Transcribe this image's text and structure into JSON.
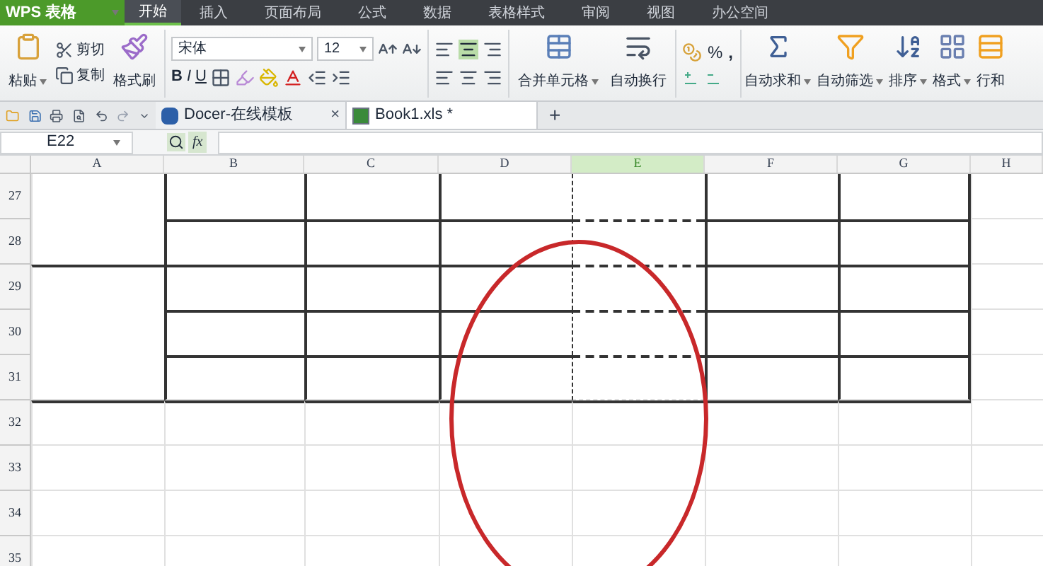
{
  "app_title": "WPS 表格",
  "menu_tabs": [
    {
      "label": "开始",
      "selected": true
    },
    {
      "label": "插入",
      "selected": false
    },
    {
      "label": "页面布局",
      "selected": false
    },
    {
      "label": "公式",
      "selected": false
    },
    {
      "label": "数据",
      "selected": false
    },
    {
      "label": "表格样式",
      "selected": false
    },
    {
      "label": "审阅",
      "selected": false
    },
    {
      "label": "视图",
      "selected": false
    },
    {
      "label": "办公空间",
      "selected": false
    }
  ],
  "ribbon": {
    "paste": "粘贴",
    "cut": "剪切",
    "copy": "复制",
    "format_painter": "格式刷",
    "font_name": "宋体",
    "font_size": "12",
    "font_styles": [
      "B",
      "I",
      "U"
    ],
    "merge": "合并单元格",
    "wrap": "自动换行",
    "percent": "%",
    "comma": ",",
    "autosum": "自动求和",
    "autofilter": "自动筛选",
    "sort": "排序",
    "format": "格式",
    "rows_cols": "行和"
  },
  "doc_tabs": [
    {
      "label": "Docer-在线模板",
      "kind": "docer",
      "selected": false,
      "close": "×"
    },
    {
      "label": "Book1.xls *",
      "kind": "sheet",
      "selected": true
    }
  ],
  "new_tab": "+",
  "formula_bar": {
    "name_box": "E22",
    "fx": "fx"
  },
  "columns": [
    {
      "label": "A",
      "selected": false
    },
    {
      "label": "B",
      "selected": false
    },
    {
      "label": "C",
      "selected": false
    },
    {
      "label": "D",
      "selected": false
    },
    {
      "label": "E",
      "selected": true
    },
    {
      "label": "F",
      "selected": false
    },
    {
      "label": "G",
      "selected": false
    },
    {
      "label": "H",
      "selected": false
    }
  ],
  "rows": [
    "27",
    "28",
    "29",
    "30",
    "31",
    "32",
    "33",
    "34",
    "35"
  ]
}
